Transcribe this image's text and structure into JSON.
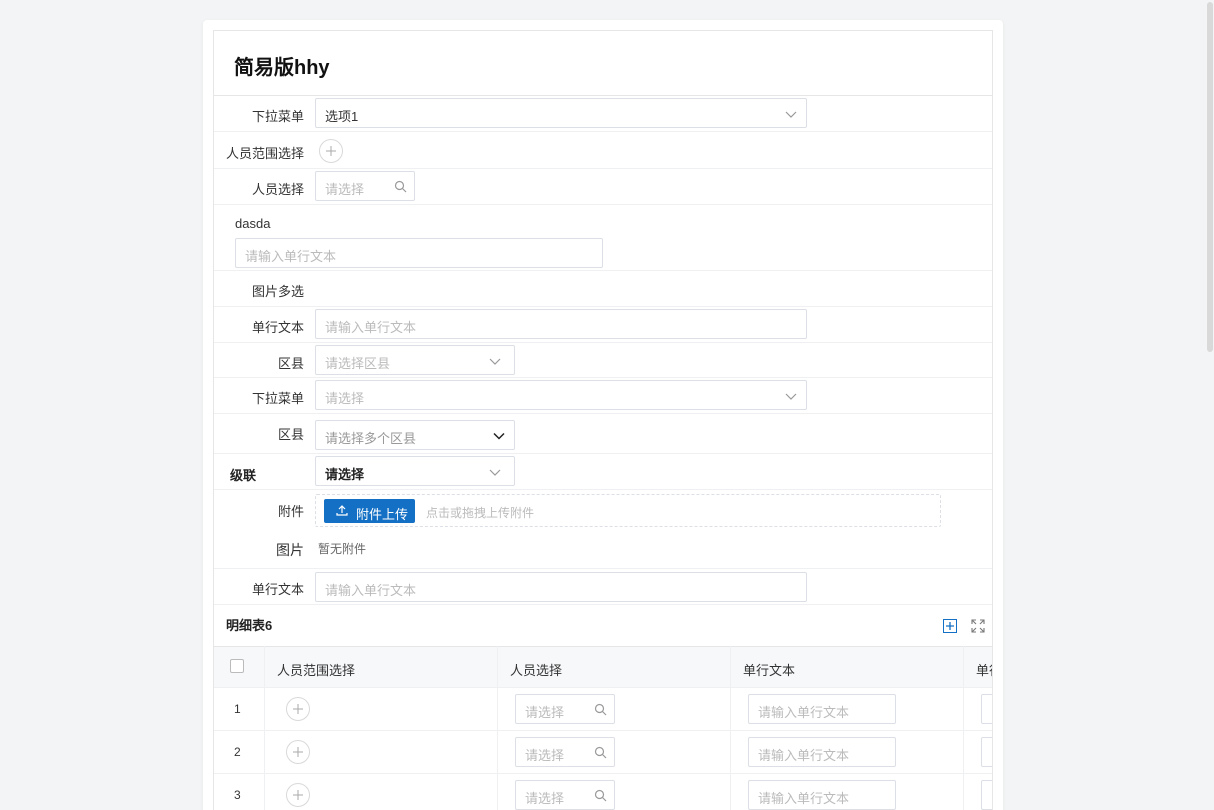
{
  "form": {
    "title": "简易版hhy",
    "fields": {
      "dropdown1": {
        "label": "下拉菜单",
        "value": "选项1"
      },
      "person_range": {
        "label": "人员范围选择"
      },
      "person_select": {
        "label": "人员选择",
        "placeholder": "请选择"
      },
      "dasda": {
        "label": "dasda",
        "placeholder": "请输入单行文本"
      },
      "image_multi": {
        "label": "图片多选"
      },
      "single_text1": {
        "label": "单行文本",
        "placeholder": "请输入单行文本"
      },
      "county1": {
        "label": "区县",
        "placeholder": "请选择区县"
      },
      "dropdown2": {
        "label": "下拉菜单",
        "placeholder": "请选择"
      },
      "county_multi": {
        "label": "区县",
        "placeholder": "请选择多个区县"
      },
      "cascade": {
        "label": "级联",
        "value": "请选择"
      },
      "attachment": {
        "label": "附件",
        "button": "附件上传",
        "hint": "点击或拖拽上传附件"
      },
      "image": {
        "label": "图片",
        "empty": "暂无附件"
      },
      "single_text2": {
        "label": "单行文本",
        "placeholder": "请输入单行文本"
      }
    }
  },
  "detail_table": {
    "title": "明细表6",
    "columns": [
      "人员范围选择",
      "人员选择",
      "单行文本",
      "单行"
    ],
    "rows": [
      {
        "index": "1",
        "person_placeholder": "请选择",
        "text_placeholder": "请输入单行文本"
      },
      {
        "index": "2",
        "person_placeholder": "请选择",
        "text_placeholder": "请输入单行文本"
      },
      {
        "index": "3",
        "person_placeholder": "请选择",
        "text_placeholder": "请输入单行文本"
      }
    ]
  },
  "icons": {
    "chevron": "chevron-down-icon",
    "search": "search-icon",
    "plus": "plus-icon",
    "upload": "upload-icon",
    "add_row": "add-square-icon",
    "fullscreen": "fullscreen-icon"
  },
  "colors": {
    "primary": "#1470c4",
    "page_bg": "#f3f4f5"
  }
}
